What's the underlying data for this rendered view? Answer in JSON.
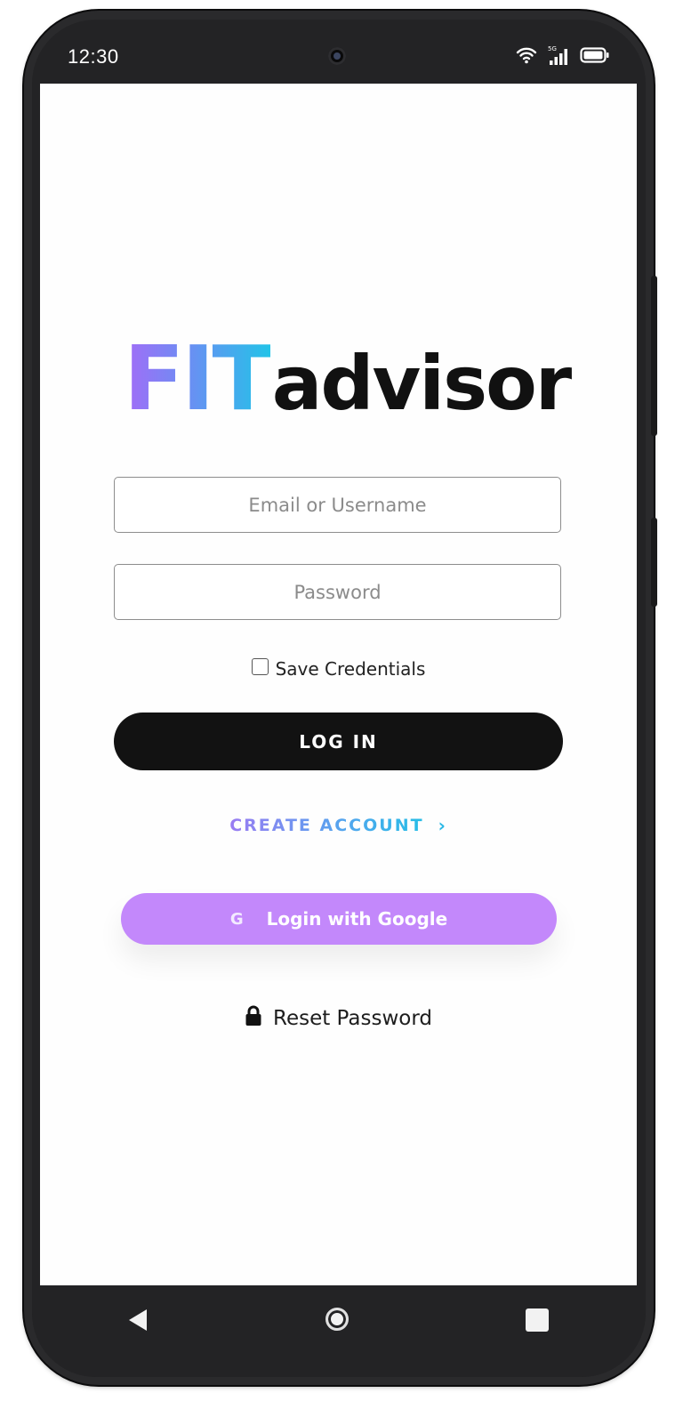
{
  "status_bar": {
    "time": "12:30",
    "network_label": "5G"
  },
  "logo": {
    "part1": "FIT",
    "part2": "advisor",
    "gradient": [
      "#a36cf7",
      "#22c3e8"
    ]
  },
  "form": {
    "email_placeholder": "Email or Username",
    "password_placeholder": "Password",
    "save_credentials_label": "Save Credentials",
    "save_credentials_checked": false,
    "login_label": "LOG IN",
    "create_account_label": "CREATE ACCOUNT",
    "create_account_chevron": "›",
    "google_icon_letter": "G",
    "google_label": "Login with Google",
    "reset_password_label": "Reset Password"
  },
  "colors": {
    "login_button": "#121212",
    "google_button": "#c388fb",
    "create_account_start": "#9a7cf2",
    "create_account_end": "#25bde6"
  },
  "icons": {
    "wifi": "wifi-icon",
    "signal": "signal-icon",
    "battery": "battery-icon",
    "lock": "lock-icon",
    "back": "back-icon",
    "home": "home-icon",
    "recent": "recent-apps-icon"
  }
}
